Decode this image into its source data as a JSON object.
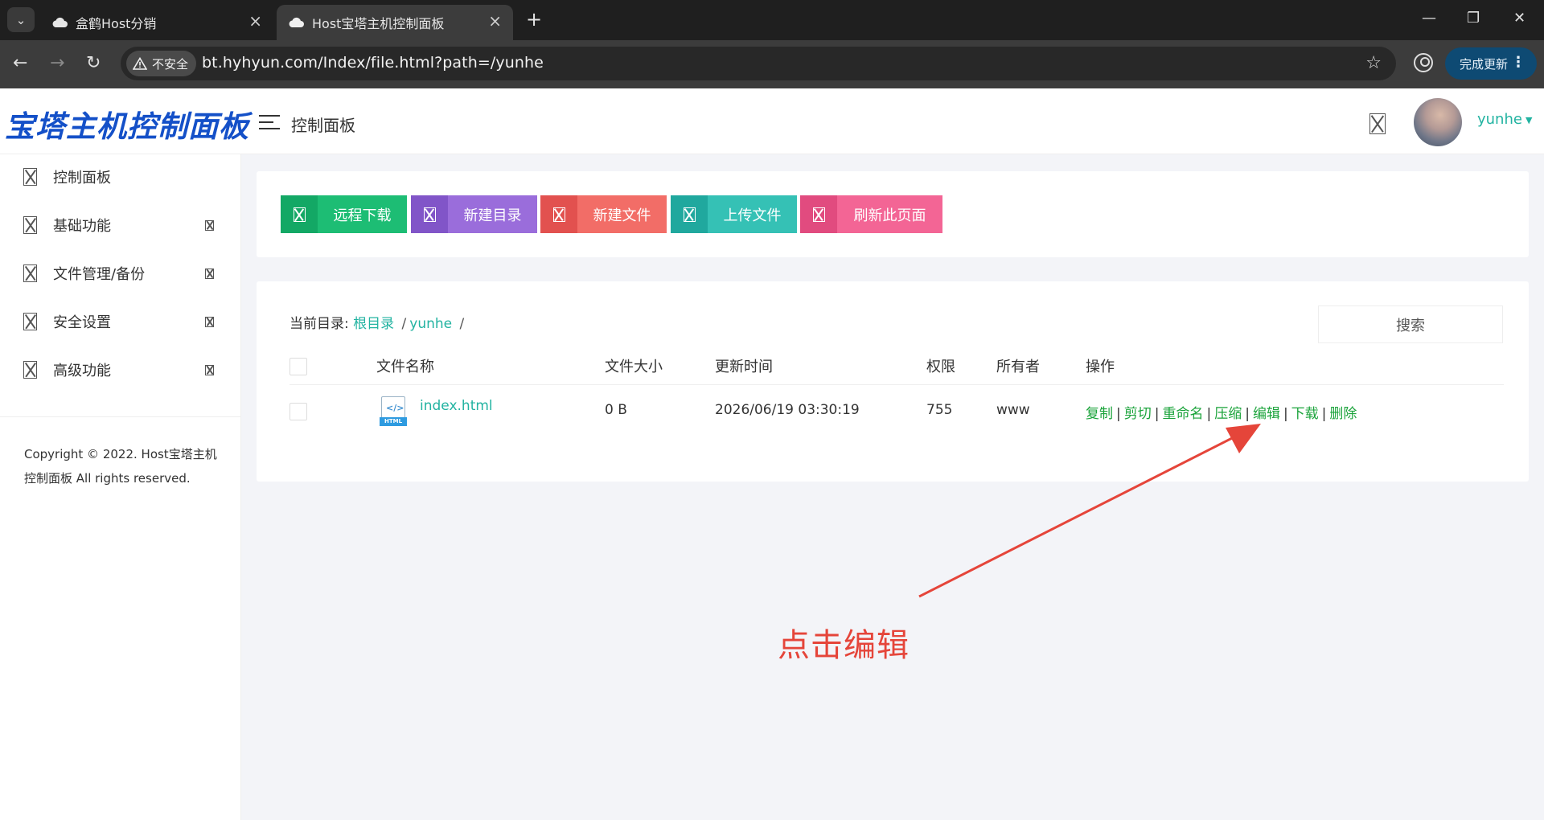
{
  "browser": {
    "tabs": [
      {
        "title": "盒鹤Host分销",
        "close": "×"
      },
      {
        "title": "Host宝塔主机控制面板",
        "close": "×"
      }
    ],
    "new_tab": "+",
    "window_controls": {
      "minimize": "—",
      "restore": "❐",
      "close": "✕"
    },
    "nav": {
      "back": "←",
      "forward": "→",
      "reload": "↻"
    },
    "security_label": "不安全",
    "url": "bt.hyhyun.com/Index/file.html?path=/yunhe",
    "update_button": "完成更新",
    "update_dots": "⋮",
    "star": "☆"
  },
  "header": {
    "logo": "宝塔主机控制面板",
    "title": "控制面板",
    "username": "yunhe",
    "caret": "▼"
  },
  "sidebar": {
    "items": [
      {
        "label": "控制面板",
        "has_arrow": false
      },
      {
        "label": "基础功能",
        "has_arrow": true
      },
      {
        "label": "文件管理/备份",
        "has_arrow": true
      },
      {
        "label": "安全设置",
        "has_arrow": true
      },
      {
        "label": "高级功能",
        "has_arrow": true
      }
    ],
    "copyright": "Copyright © 2022. Host宝塔主机控制面板 All rights reserved."
  },
  "actions": [
    {
      "label": "远程下载",
      "color": "#1dbd74"
    },
    {
      "label": "新建目录",
      "color": "#9a6ddb"
    },
    {
      "label": "新建文件",
      "color": "#f26d67"
    },
    {
      "label": "上传文件",
      "color": "#35c1b5"
    },
    {
      "label": "刷新此页面",
      "color": "#f36595"
    }
  ],
  "files": {
    "breadcrumb": {
      "prefix": "当前目录:",
      "root": "根目录",
      "sep1": "/",
      "dir": "yunhe",
      "sep2": "/"
    },
    "search_placeholder": "搜索",
    "columns": [
      "文件名称",
      "文件大小",
      "更新时间",
      "权限",
      "所有者",
      "操作"
    ],
    "rows": [
      {
        "name": "index.html",
        "size": "0 B",
        "updated": "2026/06/19 03:30:19",
        "perm": "755",
        "owner": "www",
        "icon_code": "</>",
        "icon_tag": "HTML",
        "ops": [
          "复制",
          "剪切",
          "重命名",
          "压缩",
          "编辑",
          "下载",
          "删除"
        ]
      }
    ]
  },
  "annotation": {
    "text": "点击编辑",
    "color": "#e5453a"
  },
  "colors": {
    "accent": "#22b3a1",
    "op_link": "#1aa33a",
    "logo": "#1450c8"
  }
}
